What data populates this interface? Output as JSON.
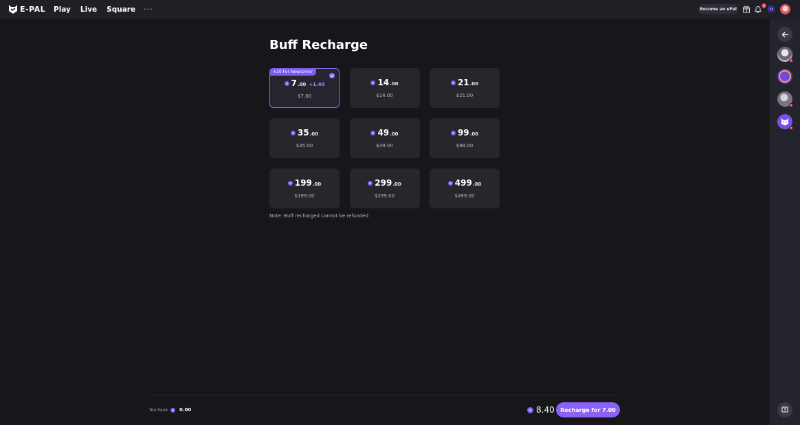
{
  "header": {
    "logo_text": "E-PAL",
    "nav": [
      "Play",
      "Live",
      "Square"
    ],
    "more_label": "···",
    "become_label": "Become an ePal",
    "notification_count": "3"
  },
  "main": {
    "title": "Buff Recharge",
    "newcomer_badge": "+20 For Newcomer",
    "packages": [
      {
        "int": "7",
        "dec": ".00",
        "bonus": "+1.40",
        "price": "$7.00",
        "selected": true
      },
      {
        "int": "14",
        "dec": ".00",
        "bonus": "",
        "price": "$14.00",
        "selected": false
      },
      {
        "int": "21",
        "dec": ".00",
        "bonus": "",
        "price": "$21.00",
        "selected": false
      },
      {
        "int": "35",
        "dec": ".00",
        "bonus": "",
        "price": "$35.00",
        "selected": false
      },
      {
        "int": "49",
        "dec": ".00",
        "bonus": "",
        "price": "$49.00",
        "selected": false
      },
      {
        "int": "99",
        "dec": ".00",
        "bonus": "",
        "price": "$99.00",
        "selected": false
      },
      {
        "int": "199",
        "dec": ".00",
        "bonus": "",
        "price": "$199.00",
        "selected": false
      },
      {
        "int": "299",
        "dec": ".00",
        "bonus": "",
        "price": "$299.00",
        "selected": false
      },
      {
        "int": "499",
        "dec": ".00",
        "bonus": "",
        "price": "$499.00",
        "selected": false
      }
    ],
    "note": "Note: Buff recharged cannot be refunded"
  },
  "footer": {
    "you_have_label": "You have",
    "you_have_value": "0.00",
    "total": "8.40",
    "recharge_label": "Recharge for 7.00"
  },
  "colors": {
    "accent": "#8b62f5",
    "background": "#16161b",
    "card": "#26262d"
  }
}
